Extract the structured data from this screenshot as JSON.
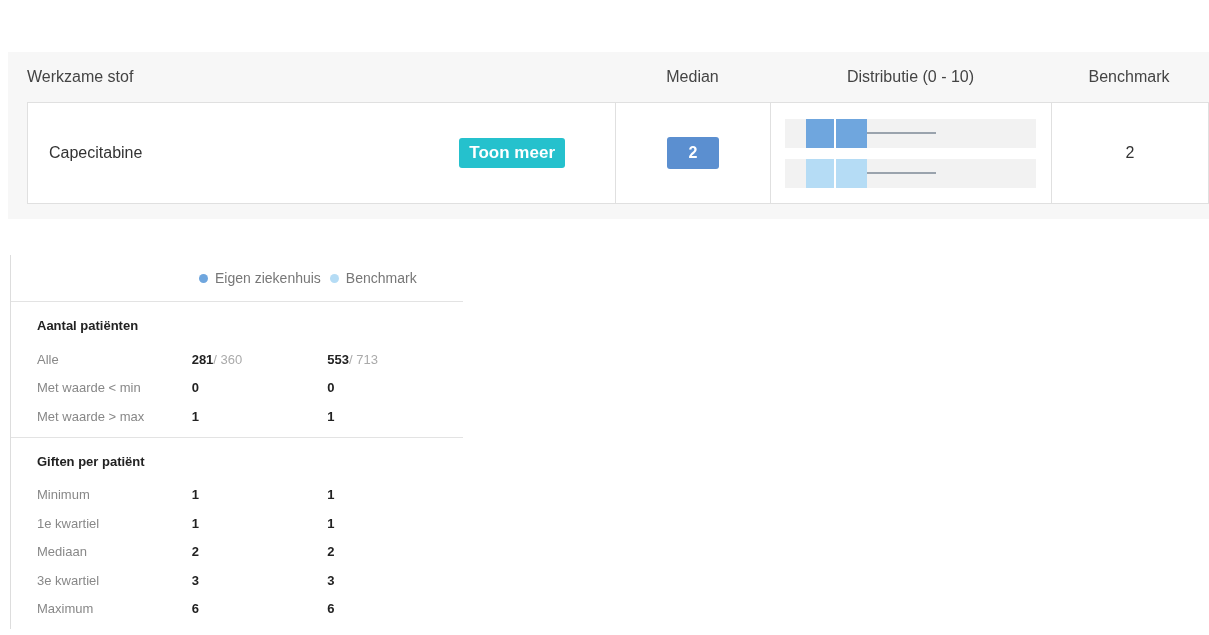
{
  "table": {
    "columns": [
      "Werkzame stof",
      "Median",
      "Distributie (0 - 10)",
      "Benchmark"
    ],
    "rows": [
      {
        "name": "Capecitabine",
        "button": "Toon meer",
        "median": "2",
        "benchmark": "2"
      }
    ]
  },
  "details": {
    "legend": [
      {
        "label": "Eigen ziekenhuis",
        "color": "#6fa6de"
      },
      {
        "label": "Benchmark",
        "color": "#b5dcf5"
      }
    ],
    "sections": [
      {
        "title": "Aantal patiënten",
        "rows": [
          {
            "label": "Alle",
            "own": "281",
            "own_total": "/ 360",
            "bench": "553",
            "bench_total": "/ 713"
          },
          {
            "label": "Met waarde < min",
            "own": "0",
            "bench": "0"
          },
          {
            "label": "Met waarde > max",
            "own": "1",
            "bench": "1"
          }
        ]
      },
      {
        "title": "Giften per patiënt",
        "rows": [
          {
            "label": "Minimum",
            "own": "1",
            "bench": "1"
          },
          {
            "label": "1e kwartiel",
            "own": "1",
            "bench": "1"
          },
          {
            "label": "Mediaan",
            "own": "2",
            "bench": "2"
          },
          {
            "label": "3e kwartiel",
            "own": "3",
            "bench": "3"
          },
          {
            "label": "Maximum",
            "own": "6",
            "bench": "6"
          }
        ]
      }
    ]
  }
}
